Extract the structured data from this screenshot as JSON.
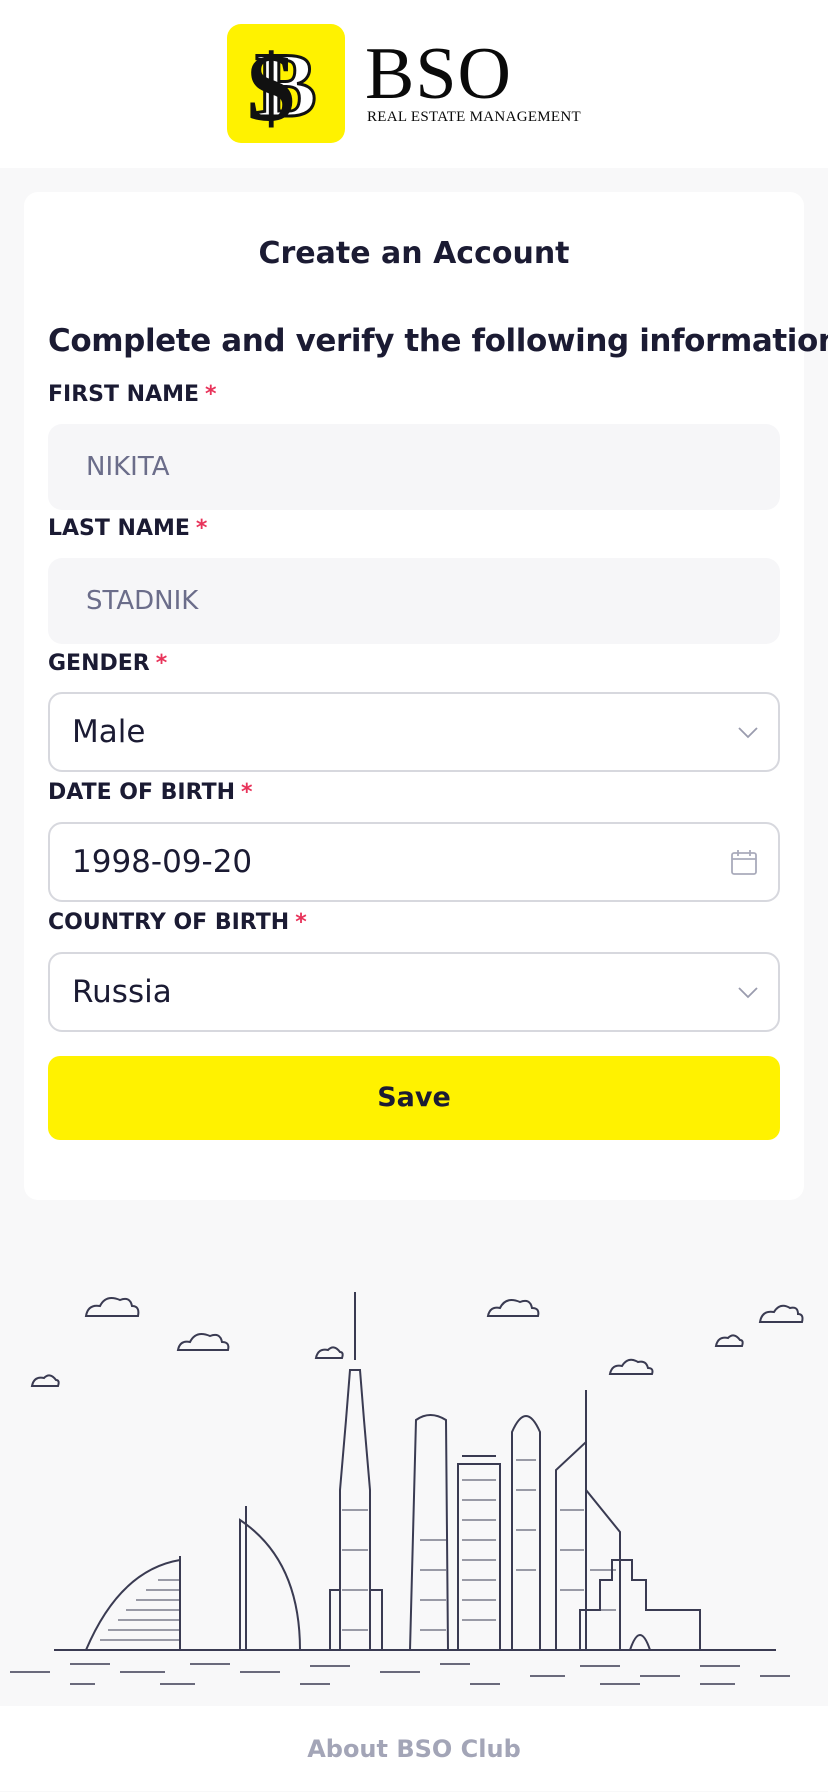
{
  "brand": {
    "name": "BSO",
    "tagline": "REAL ESTATE MANAGEMENT",
    "accent_color": "#fff200"
  },
  "form": {
    "title": "Create an Account",
    "subtitle": "Complete and verify the following information",
    "required_marker": "*",
    "first_name": {
      "label": "FIRST NAME",
      "value": "NIKITA"
    },
    "last_name": {
      "label": "LAST NAME",
      "value": "STADNIK"
    },
    "gender": {
      "label": "GENDER",
      "value": "Male"
    },
    "date_of_birth": {
      "label": "DATE OF BIRTH",
      "value": "1998-09-20"
    },
    "country_of_birth": {
      "label": "COUNTRY OF BIRTH",
      "value": "Russia"
    },
    "save_label": "Save"
  },
  "footer": {
    "link_label": "About BSO Club"
  },
  "icons": {
    "dropdown": "chevron-down-icon",
    "date": "calendar-icon",
    "logo": "dollar-b-logo"
  }
}
